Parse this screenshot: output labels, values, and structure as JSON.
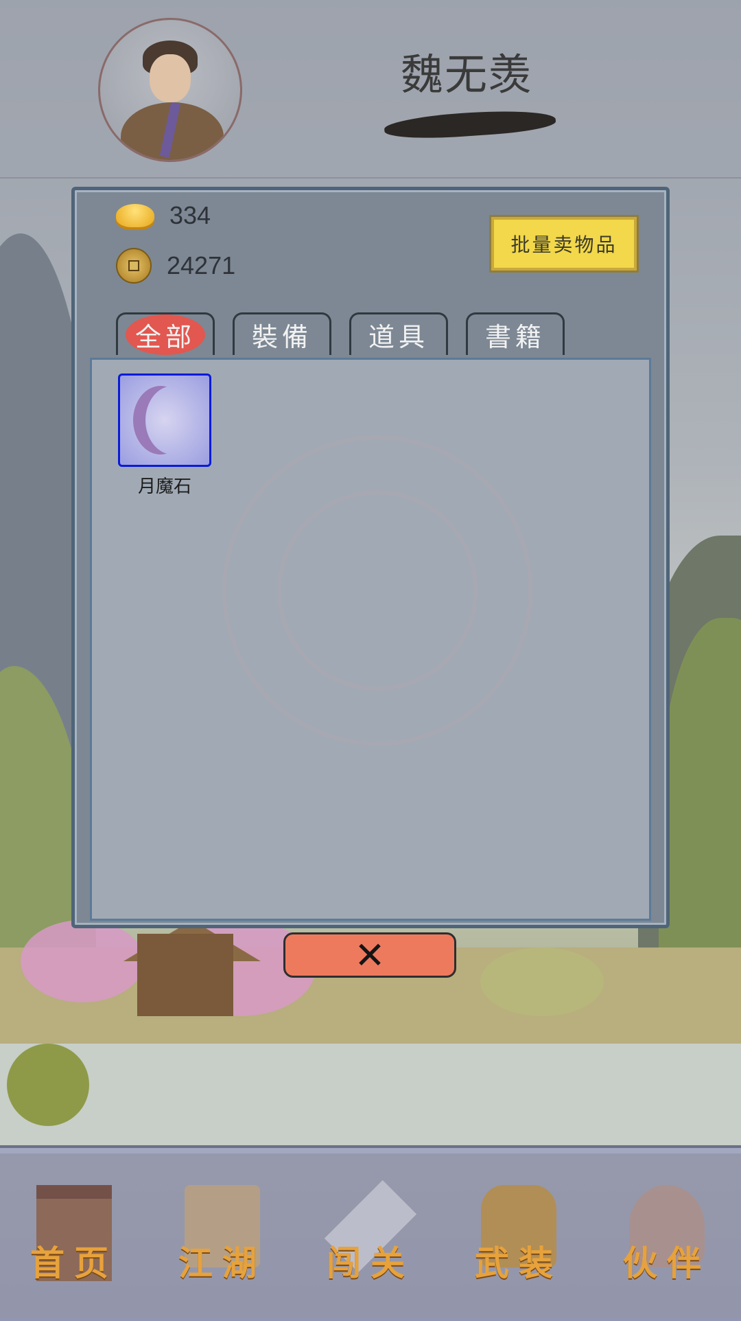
{
  "header": {
    "player_name": "魏无羡"
  },
  "currency": {
    "ingot_icon": "gold-ingot-icon",
    "ingot_amount": "334",
    "coin_icon": "copper-coin-icon",
    "coin_amount": "24271"
  },
  "bulk_sell_label": "批量卖物品",
  "tabs": [
    {
      "label": "全部",
      "active": true
    },
    {
      "label": "裝備",
      "active": false
    },
    {
      "label": "道具",
      "active": false
    },
    {
      "label": "書籍",
      "active": false
    }
  ],
  "items": [
    {
      "name": "月魔石",
      "icon": "crescent-moon-stone-icon",
      "border_color": "#0a1bd8"
    }
  ],
  "close_label": "✕",
  "nav": [
    {
      "label": "首页",
      "icon": "home-building-icon"
    },
    {
      "label": "江湖",
      "icon": "scroll-map-icon"
    },
    {
      "label": "闯关",
      "icon": "crossed-swords-icon"
    },
    {
      "label": "武装",
      "icon": "armor-icon"
    },
    {
      "label": "伙伴",
      "icon": "companions-icon"
    }
  ],
  "colors": {
    "accent_active_tab": "#e2574f",
    "bulk_button": "#f2d84a",
    "close_button": "#ee7a5e",
    "nav_label": "#e7a23c"
  }
}
